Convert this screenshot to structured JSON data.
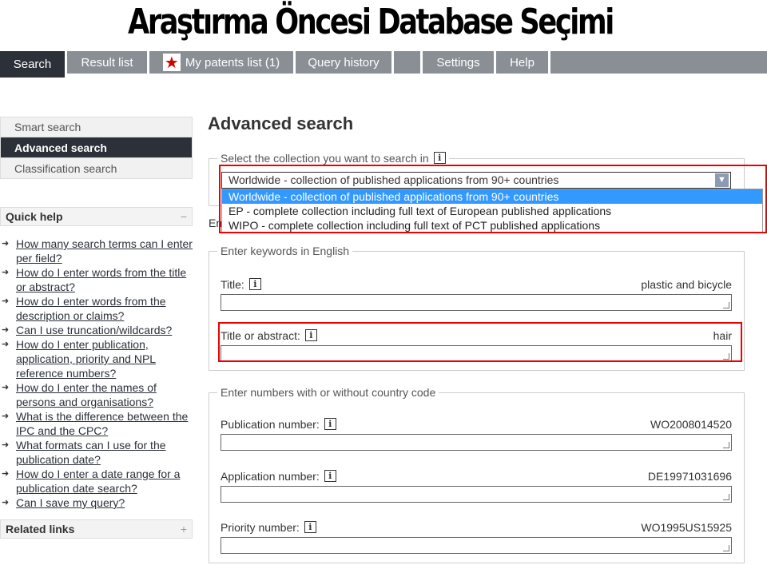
{
  "slide_title": "Araştırma Öncesi Database Seçimi",
  "nav": {
    "tabs": [
      "Search",
      "Result list",
      "My patents list (1)",
      "Query history",
      "",
      "Settings",
      "Help"
    ]
  },
  "sidebar": {
    "items": [
      "Smart search",
      "Advanced search",
      "Classification search"
    ]
  },
  "quick_help": {
    "title": "Quick help",
    "toggle": "−",
    "links": [
      "How many search terms can I enter per field?",
      "How do I enter words from the title or abstract?",
      "How do I enter words from the description or claims?",
      "Can I use truncation/wildcards?",
      "How do I enter publication, application, priority and NPL reference numbers?",
      "How do I enter the names of persons and organisations?",
      "What is the difference between the IPC and the CPC?",
      "What formats can I use for the publication date?",
      "How do I enter a date range for a publication date search?",
      "Can I save my query?"
    ]
  },
  "related_links": {
    "title": "Related links",
    "toggle": "+"
  },
  "main": {
    "title": "Advanced search",
    "collection": {
      "legend": "Select the collection you want to search in",
      "selected": "Worldwide - collection of published applications from 90+ countries",
      "options": [
        "Worldwide - collection of published applications from 90+ countries",
        "EP - complete collection including full text of European published applications",
        "WIPO - complete collection including full text of PCT published applications"
      ],
      "partial_label": "En"
    },
    "keywords": {
      "legend": "Enter keywords in English",
      "fields": [
        {
          "label": "Title:",
          "hint": "plastic and bicycle"
        },
        {
          "label": "Title or abstract:",
          "hint": "hair"
        }
      ]
    },
    "numbers": {
      "legend": "Enter numbers with or without country code",
      "fields": [
        {
          "label": "Publication number:",
          "hint": "WO2008014520"
        },
        {
          "label": "Application number:",
          "hint": "DE19971031696"
        },
        {
          "label": "Priority number:",
          "hint": "WO1995US15925"
        }
      ]
    }
  },
  "colors": {
    "highlight_box": "#e00000",
    "active_tab": "#2b3039",
    "selected_option": "#3399ff"
  }
}
